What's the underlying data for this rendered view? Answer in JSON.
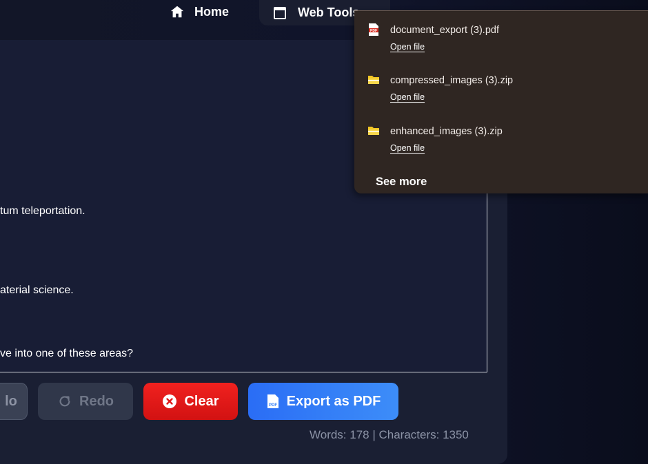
{
  "nav": {
    "home_label": "Home",
    "tools_label": "Web Tools"
  },
  "editor": {
    "lines": [
      "tum teleportation.",
      "aterial science.",
      "ve into one of these areas?"
    ]
  },
  "toolbar": {
    "undo_label": "lo",
    "redo_label": "Redo",
    "clear_label": "Clear",
    "export_label": "Export as PDF"
  },
  "stats": {
    "text": "Words: 178 | Characters: 1350"
  },
  "downloads": {
    "items": [
      {
        "name": "document_export (3).pdf",
        "action": "Open file",
        "icon": "pdf-file-icon"
      },
      {
        "name": "compressed_images (3).zip",
        "action": "Open file",
        "icon": "folder-icon"
      },
      {
        "name": "enhanced_images (3).zip",
        "action": "Open file",
        "icon": "folder-icon"
      }
    ],
    "see_more_label": "See more"
  },
  "colors": {
    "clear": "#e01a1a",
    "export": "#2f7cf6",
    "popup_bg": "#2f2622"
  }
}
